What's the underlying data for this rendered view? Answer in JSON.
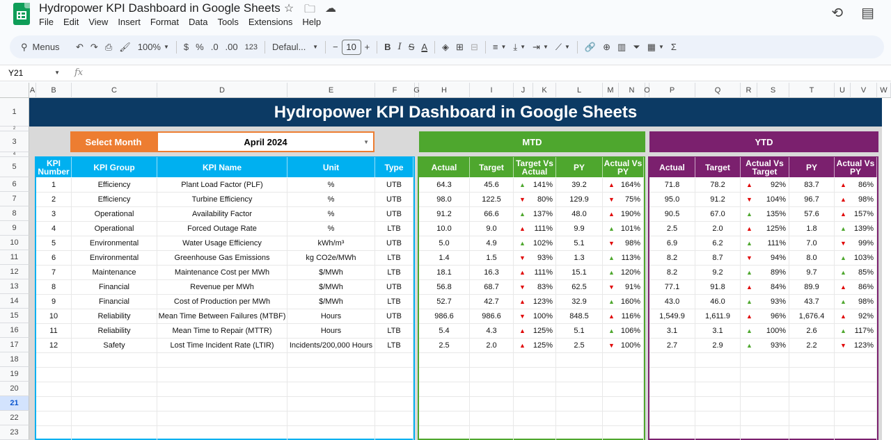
{
  "doc": {
    "title": "Hydropower KPI Dashboard in Google Sheets",
    "menus": [
      "File",
      "Edit",
      "View",
      "Insert",
      "Format",
      "Data",
      "Tools",
      "Extensions",
      "Help"
    ]
  },
  "toolbar": {
    "search_label": "Menus",
    "zoom": "100%",
    "currency": "$",
    "percent": "%",
    "dec_less": ".0",
    "dec_more": ".00",
    "number_format": "123",
    "font": "Defaul...",
    "font_size": "10"
  },
  "formula_bar": {
    "cell_ref": "Y21",
    "fx": "fx",
    "value": ""
  },
  "columns": [
    "A",
    "B",
    "C",
    "D",
    "E",
    "F",
    "G",
    "H",
    "I",
    "J",
    "K",
    "L",
    "M",
    "N",
    "O",
    "P",
    "Q",
    "R",
    "S",
    "T",
    "U",
    "V",
    "W"
  ],
  "rows": [
    "1",
    "2",
    "3",
    "4",
    "5",
    "6",
    "7",
    "8",
    "9",
    "10",
    "11",
    "12",
    "13",
    "14",
    "15",
    "16",
    "17",
    "18",
    "19",
    "20",
    "21",
    "22",
    "23"
  ],
  "selected_row": "21",
  "dashboard": {
    "banner": "Hydropower KPI Dashboard in Google Sheets",
    "select_month_label": "Select Month",
    "selected_month": "April 2024",
    "mtd_label": "MTD",
    "ytd_label": "YTD",
    "headers": {
      "kpi_number": "KPI Number",
      "kpi_group": "KPI Group",
      "kpi_name": "KPI Name",
      "unit": "Unit",
      "type": "Type",
      "mtd": [
        "Actual",
        "Target",
        "Target Vs Actual",
        "PY",
        "Actual Vs PY"
      ],
      "ytd": [
        "Actual",
        "Target",
        "Actual Vs Target",
        "PY",
        "Actual Vs PY"
      ]
    },
    "colors": {
      "blue": "#00b0f0",
      "green": "#4ea72e",
      "purple": "#7b206e",
      "orange": "#ed7d31",
      "navy": "#0c3a64"
    },
    "kpis": [
      {
        "n": "1",
        "group": "Efficiency",
        "name": "Plant Load Factor (PLF)",
        "unit": "%",
        "type": "UTB",
        "m_act": "64.3",
        "m_tgt": "45.6",
        "m_tva": "141%",
        "m_tva_dir": "up",
        "m_py": "39.2",
        "m_avp": "164%",
        "m_avp_dir": "redup",
        "y_act": "71.8",
        "y_tgt": "78.2",
        "y_avt": "92%",
        "y_avt_dir": "redup",
        "y_py": "83.7",
        "y_avp": "86%",
        "y_avp_dir": "redup"
      },
      {
        "n": "2",
        "group": "Efficiency",
        "name": "Turbine Efficiency",
        "unit": "%",
        "type": "UTB",
        "m_act": "98.0",
        "m_tgt": "122.5",
        "m_tva": "80%",
        "m_tva_dir": "down",
        "m_py": "129.9",
        "m_avp": "75%",
        "m_avp_dir": "down",
        "y_act": "95.0",
        "y_tgt": "91.2",
        "y_avt": "104%",
        "y_avt_dir": "down",
        "y_py": "96.7",
        "y_avp": "98%",
        "y_avp_dir": "redup"
      },
      {
        "n": "3",
        "group": "Operational",
        "name": "Availability Factor",
        "unit": "%",
        "type": "UTB",
        "m_act": "91.2",
        "m_tgt": "66.6",
        "m_tva": "137%",
        "m_tva_dir": "up",
        "m_py": "48.0",
        "m_avp": "190%",
        "m_avp_dir": "redup",
        "y_act": "90.5",
        "y_tgt": "67.0",
        "y_avt": "135%",
        "y_avt_dir": "up",
        "y_py": "57.6",
        "y_avp": "157%",
        "y_avp_dir": "redup"
      },
      {
        "n": "4",
        "group": "Operational",
        "name": "Forced Outage Rate",
        "unit": "%",
        "type": "LTB",
        "m_act": "10.0",
        "m_tgt": "9.0",
        "m_tva": "111%",
        "m_tva_dir": "redup",
        "m_py": "9.9",
        "m_avp": "101%",
        "m_avp_dir": "up",
        "y_act": "2.5",
        "y_tgt": "2.0",
        "y_avt": "125%",
        "y_avt_dir": "redup",
        "y_py": "1.8",
        "y_avp": "139%",
        "y_avp_dir": "up"
      },
      {
        "n": "5",
        "group": "Environmental",
        "name": "Water Usage Efficiency",
        "unit": "kWh/m³",
        "type": "UTB",
        "m_act": "5.0",
        "m_tgt": "4.9",
        "m_tva": "102%",
        "m_tva_dir": "up",
        "m_py": "5.1",
        "m_avp": "98%",
        "m_avp_dir": "down",
        "y_act": "6.9",
        "y_tgt": "6.2",
        "y_avt": "111%",
        "y_avt_dir": "up",
        "y_py": "7.0",
        "y_avp": "99%",
        "y_avp_dir": "down"
      },
      {
        "n": "6",
        "group": "Environmental",
        "name": "Greenhouse Gas Emissions",
        "unit": "kg CO2e/MWh",
        "type": "LTB",
        "m_act": "1.4",
        "m_tgt": "1.5",
        "m_tva": "93%",
        "m_tva_dir": "down",
        "m_py": "1.3",
        "m_avp": "113%",
        "m_avp_dir": "up",
        "y_act": "8.2",
        "y_tgt": "8.7",
        "y_avt": "94%",
        "y_avt_dir": "down",
        "y_py": "8.0",
        "y_avp": "103%",
        "y_avp_dir": "up"
      },
      {
        "n": "7",
        "group": "Maintenance",
        "name": "Maintenance Cost per MWh",
        "unit": "$/MWh",
        "type": "LTB",
        "m_act": "18.1",
        "m_tgt": "16.3",
        "m_tva": "111%",
        "m_tva_dir": "redup",
        "m_py": "15.1",
        "m_avp": "120%",
        "m_avp_dir": "up",
        "y_act": "8.2",
        "y_tgt": "9.2",
        "y_avt": "89%",
        "y_avt_dir": "up",
        "y_py": "9.7",
        "y_avp": "85%",
        "y_avp_dir": "up"
      },
      {
        "n": "8",
        "group": "Financial",
        "name": "Revenue per MWh",
        "unit": "$/MWh",
        "type": "UTB",
        "m_act": "56.8",
        "m_tgt": "68.7",
        "m_tva": "83%",
        "m_tva_dir": "down",
        "m_py": "62.5",
        "m_avp": "91%",
        "m_avp_dir": "down",
        "y_act": "77.1",
        "y_tgt": "91.8",
        "y_avt": "84%",
        "y_avt_dir": "redup",
        "y_py": "89.9",
        "y_avp": "86%",
        "y_avp_dir": "redup"
      },
      {
        "n": "9",
        "group": "Financial",
        "name": "Cost of Production per MWh",
        "unit": "$/MWh",
        "type": "LTB",
        "m_act": "52.7",
        "m_tgt": "42.7",
        "m_tva": "123%",
        "m_tva_dir": "redup",
        "m_py": "32.9",
        "m_avp": "160%",
        "m_avp_dir": "up",
        "y_act": "43.0",
        "y_tgt": "46.0",
        "y_avt": "93%",
        "y_avt_dir": "up",
        "y_py": "43.7",
        "y_avp": "98%",
        "y_avp_dir": "up"
      },
      {
        "n": "10",
        "group": "Reliability",
        "name": "Mean Time Between Failures (MTBF)",
        "unit": "Hours",
        "type": "UTB",
        "m_act": "986.6",
        "m_tgt": "986.6",
        "m_tva": "100%",
        "m_tva_dir": "down",
        "m_py": "848.5",
        "m_avp": "116%",
        "m_avp_dir": "redup",
        "y_act": "1,549.9",
        "y_tgt": "1,611.9",
        "y_avt": "96%",
        "y_avt_dir": "redup",
        "y_py": "1,676.4",
        "y_avp": "92%",
        "y_avp_dir": "redup"
      },
      {
        "n": "11",
        "group": "Reliability",
        "name": "Mean Time to Repair (MTTR)",
        "unit": "Hours",
        "type": "LTB",
        "m_act": "5.4",
        "m_tgt": "4.3",
        "m_tva": "125%",
        "m_tva_dir": "redup",
        "m_py": "5.1",
        "m_avp": "106%",
        "m_avp_dir": "up",
        "y_act": "3.1",
        "y_tgt": "3.1",
        "y_avt": "100%",
        "y_avt_dir": "up",
        "y_py": "2.6",
        "y_avp": "117%",
        "y_avp_dir": "up"
      },
      {
        "n": "12",
        "group": "Safety",
        "name": "Lost Time Incident Rate (LTIR)",
        "unit": "Incidents/200,000 Hours",
        "type": "LTB",
        "m_act": "2.5",
        "m_tgt": "2.0",
        "m_tva": "125%",
        "m_tva_dir": "redup",
        "m_py": "2.5",
        "m_avp": "100%",
        "m_avp_dir": "down",
        "y_act": "2.7",
        "y_tgt": "2.9",
        "y_avt": "93%",
        "y_avt_dir": "up",
        "y_py": "2.2",
        "y_avp": "123%",
        "y_avp_dir": "down"
      }
    ]
  }
}
